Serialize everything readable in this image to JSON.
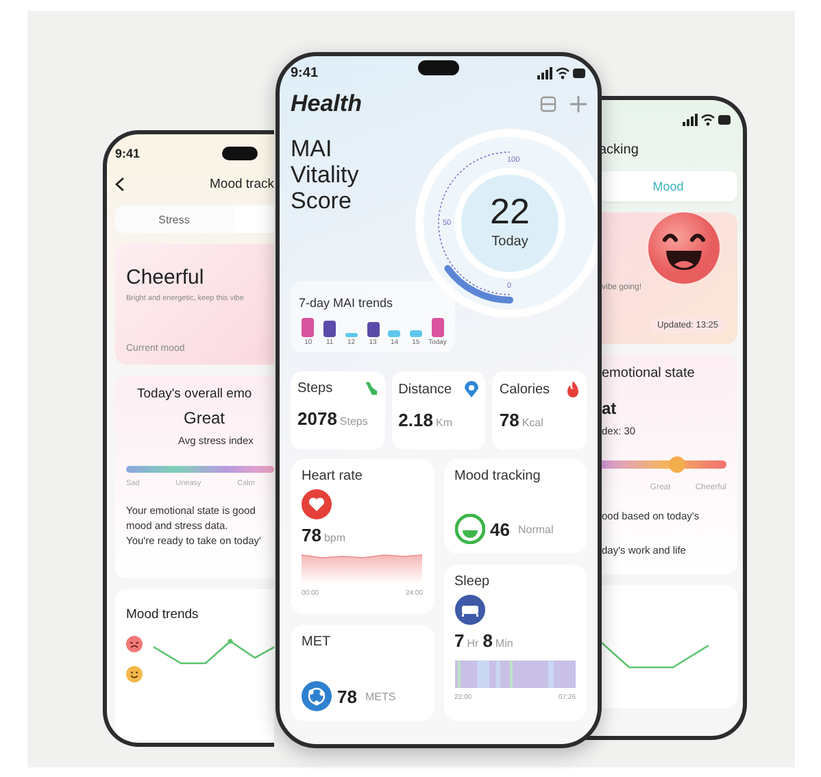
{
  "left_phone": {
    "status_time": "9:41",
    "title": "Mood track",
    "tabs": [
      {
        "label": "Stress",
        "selected": false
      }
    ],
    "mood_card": {
      "mood": "Cheerful",
      "description": "Bright and energetic, keep this vibe",
      "caption": "Current mood"
    },
    "overall_card": {
      "title": "Today's overall emo",
      "rating": "Great",
      "stress_label": "Avg stress index",
      "scale_labels": [
        "Sad",
        "Uneasy",
        "Calm"
      ],
      "summary_lines": [
        "Your emotional state is good",
        "mood and stress data.",
        "You're ready to take on today'"
      ]
    },
    "trends_card": {
      "title": "Mood trends"
    }
  },
  "center_phone": {
    "status_time": "9:41",
    "title": "Health",
    "score_title": "MAI Vitality Score",
    "gauge": {
      "value": "22",
      "caption": "Today",
      "ticks": [
        "100",
        "50",
        "0"
      ]
    },
    "trends": {
      "title": "7-day MAI trends",
      "days": [
        "10",
        "11",
        "12",
        "13",
        "14",
        "15",
        "Today"
      ]
    },
    "metrics": [
      {
        "label": "Steps",
        "value": "2078",
        "unit": "Steps",
        "kind": "steps"
      },
      {
        "label": "Distance",
        "value": "2.18",
        "unit": "Km",
        "kind": "distance"
      },
      {
        "label": "Calories",
        "value": "78",
        "unit": "Kcal",
        "kind": "calories"
      }
    ],
    "heart_rate": {
      "title": "Heart rate",
      "value": "78",
      "unit": "bpm",
      "start": "00:00",
      "end": "24:00"
    },
    "mood_tracking": {
      "title": "Mood tracking",
      "value": "46",
      "status": "Normal"
    },
    "sleep": {
      "title": "Sleep",
      "hours": "7",
      "hours_unit": "Hr",
      "minutes": "8",
      "minutes_unit": "Min",
      "start": "22:00",
      "end": "07:26"
    },
    "met": {
      "title": "MET",
      "value": "78",
      "unit": "METS"
    }
  },
  "right_phone": {
    "title": "acking",
    "tabs": [
      {
        "label": "Mood",
        "selected": true
      }
    ],
    "mood_card": {
      "description": "vibe going!",
      "updated": "Updated: 13:25"
    },
    "state_card": {
      "title": "emotional state",
      "rating": "at",
      "stress_label": "dex: 30",
      "level": 0.6,
      "scale_labels": [
        "Great",
        "Cheerful"
      ],
      "summary_lines": [
        "ood based on today's",
        "day's work and life"
      ]
    }
  }
}
